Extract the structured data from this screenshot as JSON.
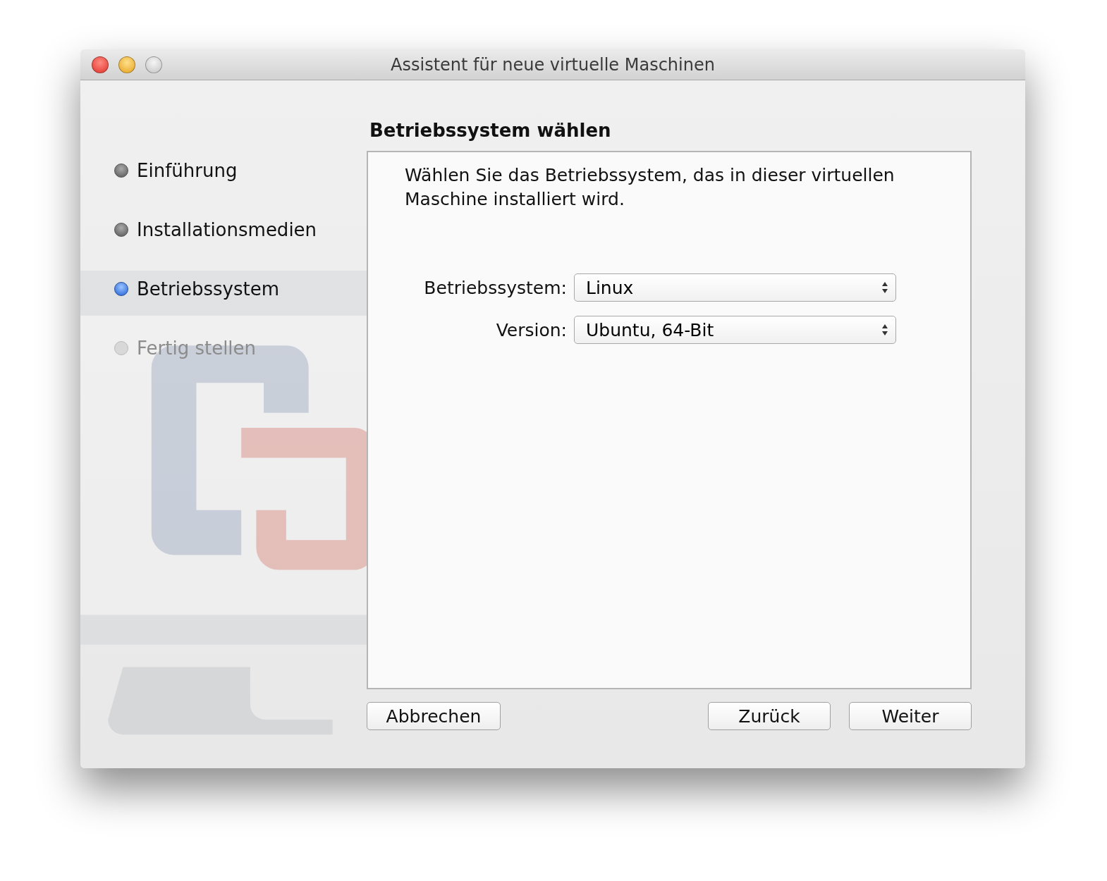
{
  "window": {
    "title": "Assistent für neue virtuelle Maschinen"
  },
  "steps": [
    {
      "label": "Einführung",
      "selected": false,
      "disabled": false
    },
    {
      "label": "Installationsmedien",
      "selected": false,
      "disabled": false
    },
    {
      "label": "Betriebssystem",
      "selected": true,
      "disabled": false
    },
    {
      "label": "Fertig stellen",
      "selected": false,
      "disabled": true
    }
  ],
  "heading": "Betriebssystem wählen",
  "description": "Wählen Sie das Betriebssystem, das in dieser virtuellen Maschine installiert wird.",
  "fields": [
    {
      "label": "Betriebssystem:",
      "value": "Linux"
    },
    {
      "label": "Version:",
      "value": "Ubuntu, 64-Bit"
    }
  ],
  "buttons": {
    "cancel": "Abbrechen",
    "back": "Zurück",
    "next": "Weiter"
  }
}
